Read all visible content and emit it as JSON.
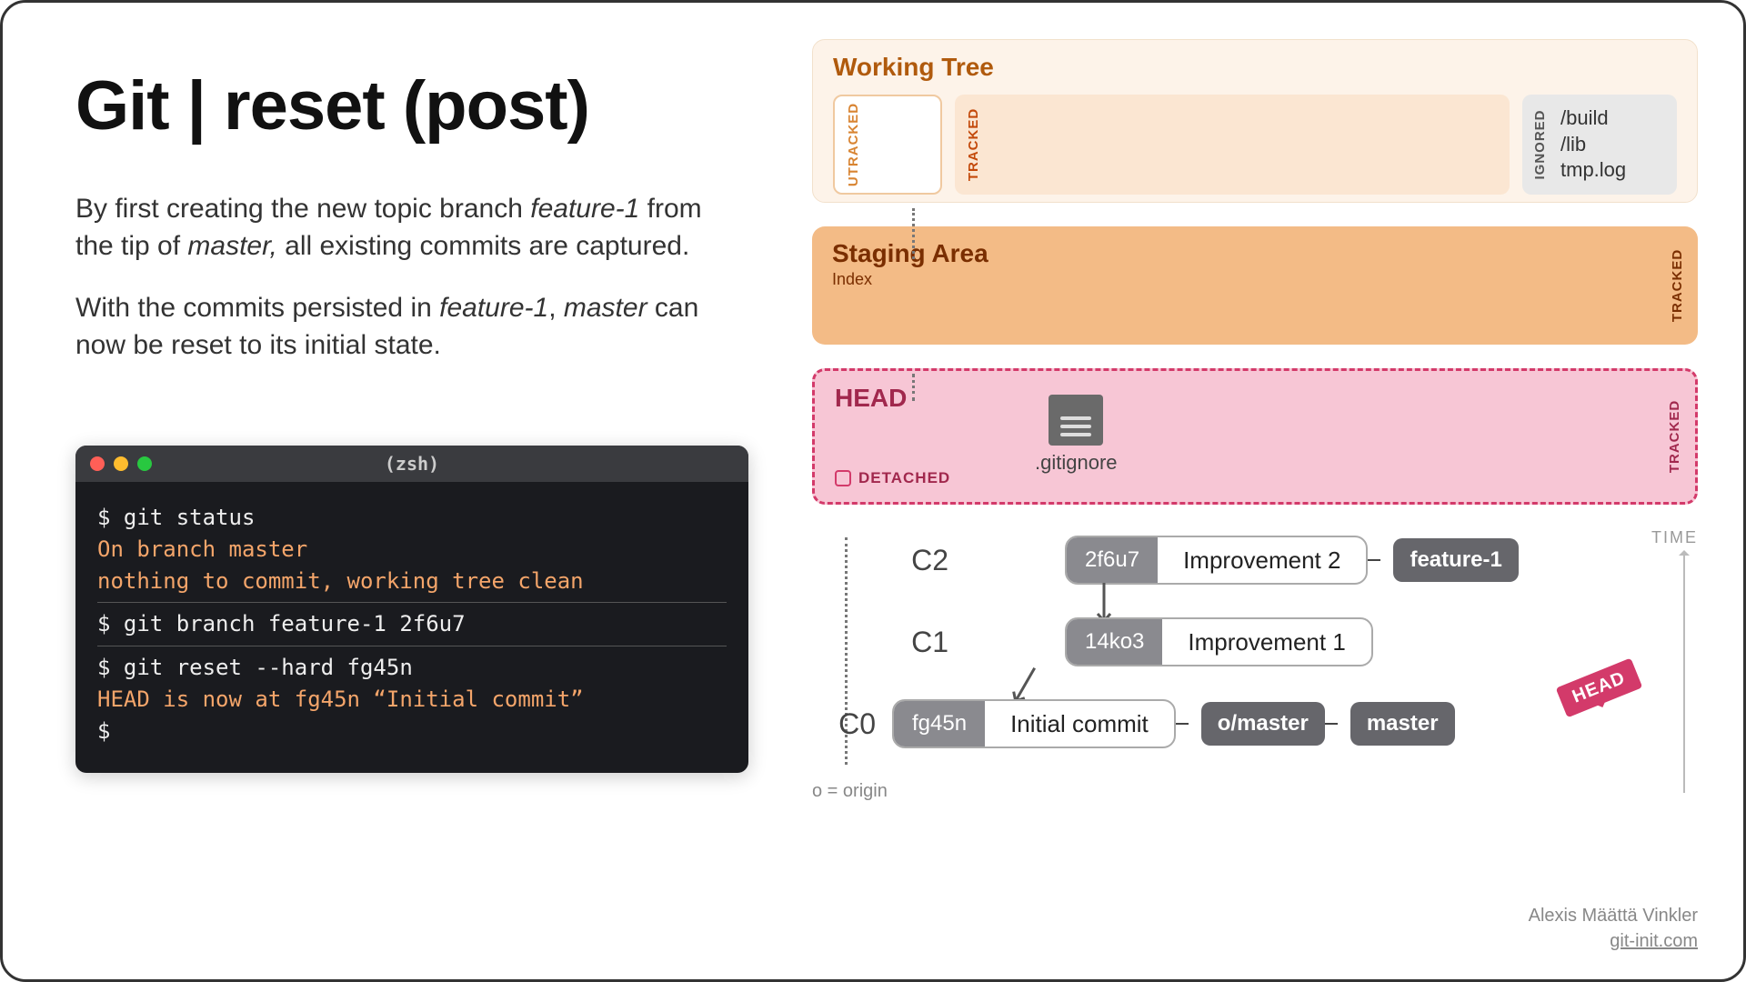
{
  "title": "Git | reset (post)",
  "desc1_pre": "By first creating the new topic branch ",
  "desc1_em1": "feature-1",
  "desc1_mid": " from the tip of ",
  "desc1_em2": "master,",
  "desc1_post": " all existing commits are captured.",
  "desc2_pre": "With the commits persisted in ",
  "desc2_em1": "feature-1",
  "desc2_mid": ", ",
  "desc2_em2": "master",
  "desc2_post": " can now be reset to its initial state.",
  "terminal": {
    "label": "(zsh)",
    "l1": "$ git status",
    "l2": "On branch master",
    "l3": "nothing to commit, working tree clean",
    "l4": "$ git branch feature-1 2f6u7",
    "l5": "$ git reset --hard fg45n",
    "l6": "HEAD is now at fg45n “Initial commit”",
    "l7": "$"
  },
  "zones": {
    "wt": {
      "title": "Working Tree",
      "utracked": "UTRACKED",
      "tracked": "TRACKED",
      "ignored_lbl": "IGNORED",
      "ignored_files": [
        "/build",
        "/lib",
        "tmp.log"
      ]
    },
    "sa": {
      "title": "Staging Area",
      "sub": "Index",
      "tracked": "TRACKED"
    },
    "hd": {
      "title": "HEAD",
      "detached": "DETACHED",
      "file": ".gitignore",
      "tracked": "TRACKED"
    }
  },
  "commits": {
    "c2": {
      "lbl": "C2",
      "sha": "2f6u7",
      "msg": "Improvement 2",
      "tag": "feature-1"
    },
    "c1": {
      "lbl": "C1",
      "sha": "14ko3",
      "msg": "Improvement 1"
    },
    "c0": {
      "lbl": "C0",
      "sha": "fg45n",
      "msg": "Initial commit",
      "tag1": "o/master",
      "tag2": "master"
    }
  },
  "time": "TIME",
  "head_flag": "HEAD",
  "origin_note": "o = origin",
  "credit": {
    "name": "Alexis Määttä Vinkler",
    "site": "git-init.com"
  }
}
